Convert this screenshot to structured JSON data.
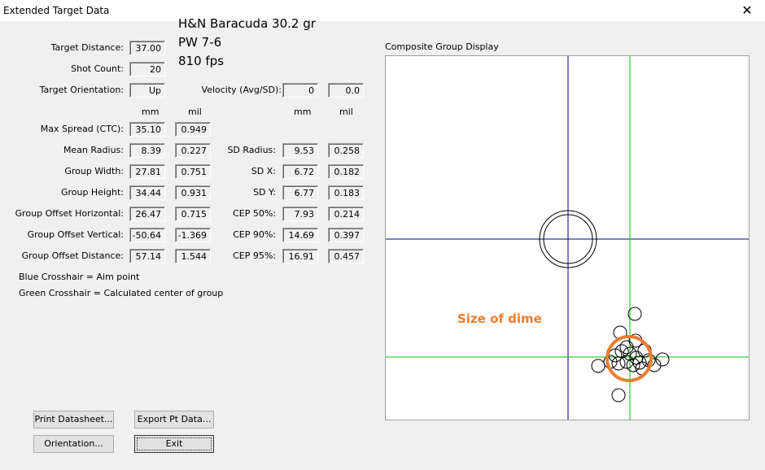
{
  "window": {
    "title": "Extended Target Data",
    "close_glyph": "✕"
  },
  "annotation": {
    "line1": "H&N Baracuda 30.2 gr",
    "line2": "PW 7-6",
    "line3": "810 fps",
    "dime_label": "Size of dime",
    "dime_color": "#ed7d31"
  },
  "fields": {
    "target_distance": {
      "label": "Target Distance:",
      "value": "37.00"
    },
    "shot_count": {
      "label": "Shot Count:",
      "value": "20"
    },
    "target_orientation": {
      "label": "Target Orientation:",
      "value": "Up"
    },
    "velocity": {
      "label": "Velocity (Avg/SD):",
      "avg": "0",
      "sd": "0.0"
    }
  },
  "units": {
    "mm": "mm",
    "mil": "mil"
  },
  "left_stats": [
    {
      "label": "Max Spread (CTC):",
      "mm": "35.10",
      "mil": "0.949"
    },
    {
      "label": "Mean Radius:",
      "mm": "8.39",
      "mil": "0.227"
    },
    {
      "label": "Group Width:",
      "mm": "27.81",
      "mil": "0.751"
    },
    {
      "label": "Group Height:",
      "mm": "34.44",
      "mil": "0.931"
    },
    {
      "label": "Group Offset Horizontal:",
      "mm": "26.47",
      "mil": "0.715"
    },
    {
      "label": "Group Offset Vertical:",
      "mm": "-50.64",
      "mil": "-1.369"
    },
    {
      "label": "Group Offset Distance:",
      "mm": "57.14",
      "mil": "1.544"
    }
  ],
  "right_stats": [
    {
      "label": "SD Radius:",
      "mm": "9.53",
      "mil": "0.258"
    },
    {
      "label": "SD X:",
      "mm": "6.72",
      "mil": "0.182"
    },
    {
      "label": "SD Y:",
      "mm": "6.77",
      "mil": "0.183"
    },
    {
      "label": "CEP 50%:",
      "mm": "7.93",
      "mil": "0.214"
    },
    {
      "label": "CEP 90%:",
      "mm": "14.69",
      "mil": "0.397"
    },
    {
      "label": "CEP 95%:",
      "mm": "16.91",
      "mil": "0.457"
    }
  ],
  "legend": {
    "blue": "Blue Crosshair = Aim point",
    "green": "Green Crosshair = Calculated center of group"
  },
  "graph": {
    "title": "Composite Group Display",
    "aim_color": "#000080",
    "center_color": "#00c000"
  },
  "buttons": {
    "print": "Print Datasheet...",
    "export": "Export Pt Data...",
    "orientation": "Orientation...",
    "exit": "Exit"
  }
}
